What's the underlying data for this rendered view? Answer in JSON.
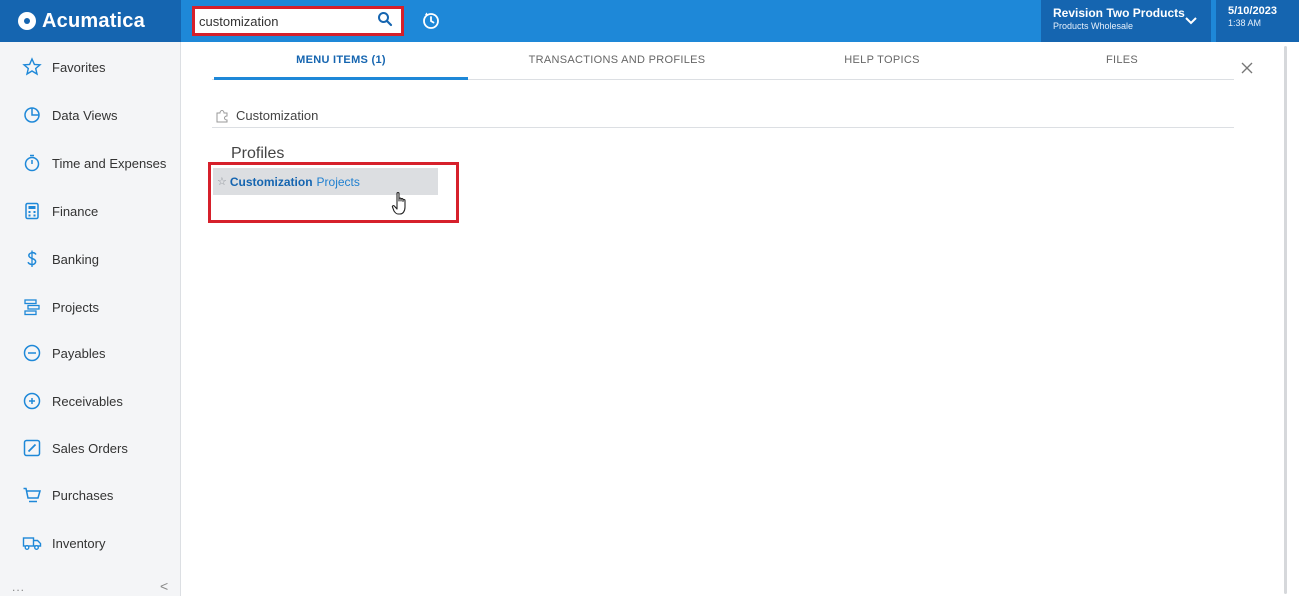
{
  "app": {
    "brand": "Acumatica"
  },
  "search": {
    "value": "customization",
    "placeholder": ""
  },
  "company": {
    "name": "Revision Two Products",
    "branch": "Products Wholesale"
  },
  "datetime": {
    "date": "5/10/2023",
    "time": "1:38 AM"
  },
  "sidebar": {
    "items": [
      {
        "label": "Favorites",
        "icon": "star-icon"
      },
      {
        "label": "Data Views",
        "icon": "pie-chart-icon"
      },
      {
        "label": "Time and Expenses",
        "icon": "stopwatch-icon"
      },
      {
        "label": "Finance",
        "icon": "calculator-icon"
      },
      {
        "label": "Banking",
        "icon": "dollar-icon"
      },
      {
        "label": "Projects",
        "icon": "projects-icon"
      },
      {
        "label": "Payables",
        "icon": "minus-circle-icon"
      },
      {
        "label": "Receivables",
        "icon": "plus-circle-icon"
      },
      {
        "label": "Sales Orders",
        "icon": "edit-icon"
      },
      {
        "label": "Purchases",
        "icon": "cart-icon"
      },
      {
        "label": "Inventory",
        "icon": "truck-icon"
      }
    ],
    "more": "...",
    "collapse": "<"
  },
  "tabs": [
    {
      "label": "MENU ITEMS (1)",
      "active": true
    },
    {
      "label": "TRANSACTIONS AND PROFILES",
      "active": false
    },
    {
      "label": "HELP TOPICS",
      "active": false
    },
    {
      "label": "FILES",
      "active": false
    }
  ],
  "results": {
    "menu_item": "Customization",
    "profiles_heading": "Profiles",
    "profile_item": {
      "bold": "Customization",
      "rest": "Projects"
    }
  },
  "colors": {
    "topbar": "#1e88d8",
    "brand_dark": "#1565b0",
    "highlight": "#d6202b"
  }
}
